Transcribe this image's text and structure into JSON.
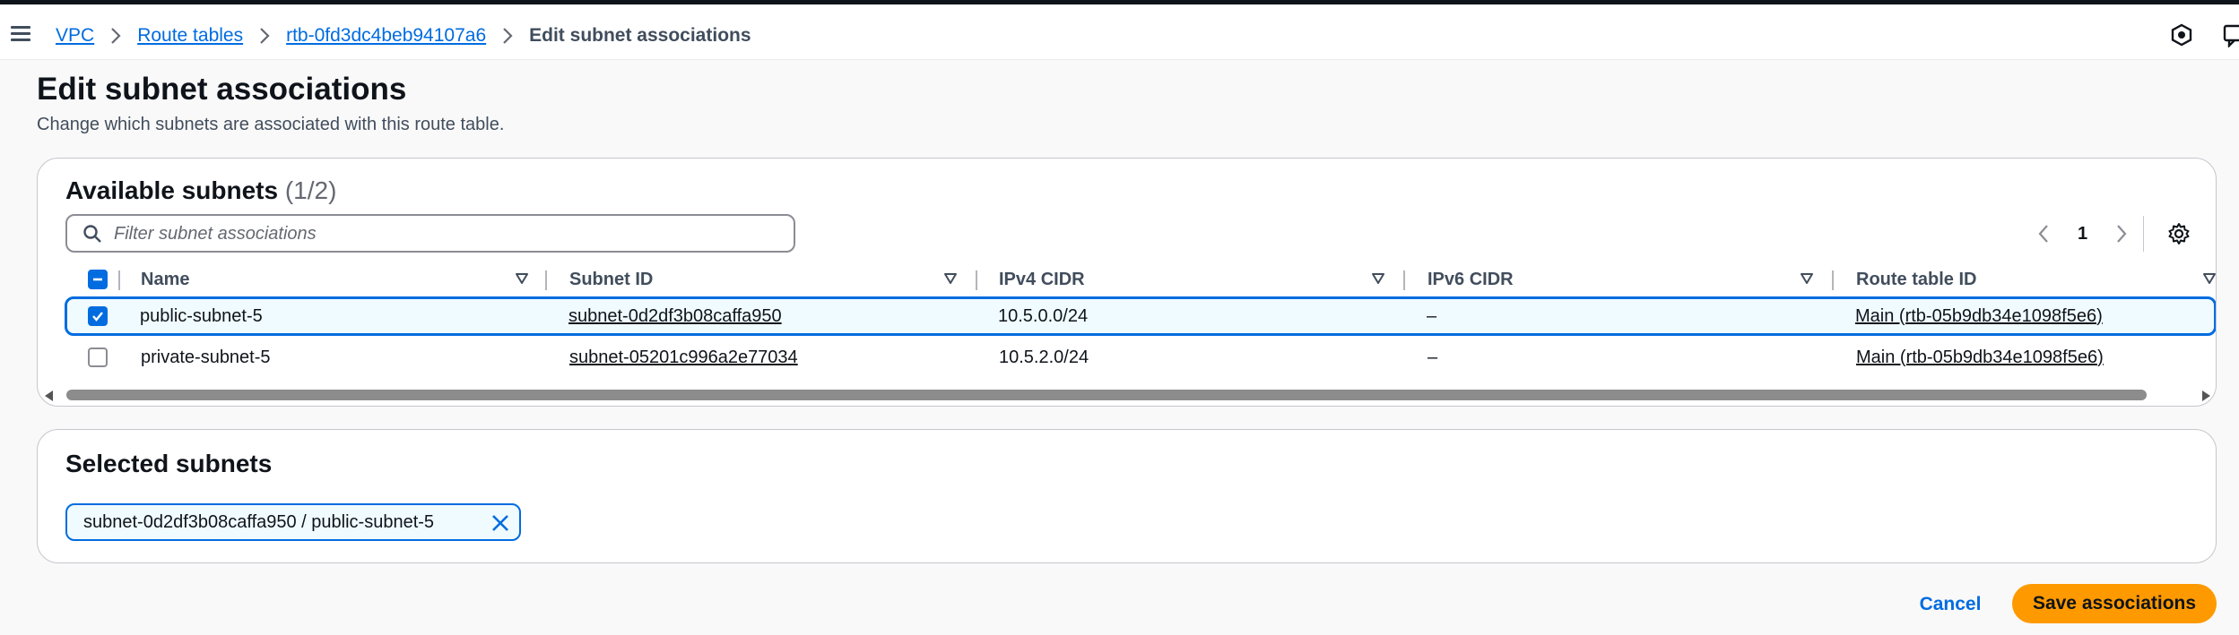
{
  "breadcrumb": {
    "items": [
      "VPC",
      "Route tables",
      "rtb-0fd3dc4beb94107a6"
    ],
    "current": "Edit subnet associations"
  },
  "header": {
    "title": "Edit subnet associations",
    "description": "Change which subnets are associated with this route table."
  },
  "available": {
    "title": "Available subnets",
    "count": "(1/2)",
    "search_placeholder": "Filter subnet associations",
    "page": "1",
    "columns": [
      "Name",
      "Subnet ID",
      "IPv4 CIDR",
      "IPv6 CIDR",
      "Route table ID"
    ],
    "rows": [
      {
        "checked": true,
        "name": "public-subnet-5",
        "subnet_id": "subnet-0d2df3b08caffa950",
        "ipv4": "10.5.0.0/24",
        "ipv6": "–",
        "route_table": "Main (rtb-05b9db34e1098f5e6)"
      },
      {
        "checked": false,
        "name": "private-subnet-5",
        "subnet_id": "subnet-05201c996a2e77034",
        "ipv4": "10.5.2.0/24",
        "ipv6": "–",
        "route_table": "Main (rtb-05b9db34e1098f5e6)"
      }
    ]
  },
  "selected": {
    "title": "Selected subnets",
    "tokens": [
      "subnet-0d2df3b08caffa950 / public-subnet-5"
    ]
  },
  "footer": {
    "cancel_label": "Cancel",
    "save_label": "Save associations"
  },
  "colors": {
    "link": "#006ce0",
    "primary_button": "#ff9900",
    "selected_row_bg": "#f0fbff"
  }
}
